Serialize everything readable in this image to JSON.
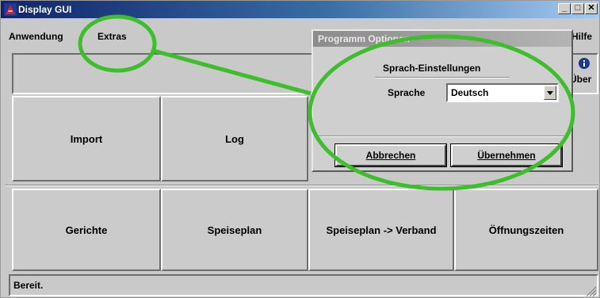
{
  "window": {
    "title": "Display GUI",
    "controls": {
      "minimize": "_",
      "maximize": "□",
      "close": "✕"
    }
  },
  "menubar": {
    "items": [
      {
        "label": "Anwendung"
      },
      {
        "label": "Extras"
      }
    ],
    "help": "Hilfe"
  },
  "about": {
    "label": "Über",
    "icon": "info-icon"
  },
  "buttons": {
    "row1": [
      "Import",
      "Log"
    ],
    "row2": [
      "Gerichte",
      "Speiseplan",
      "Speiseplan -> Verband",
      "Öffnungszeiten"
    ]
  },
  "statusbar": {
    "text": "Bereit."
  },
  "dialog": {
    "title": "Programm Optionen",
    "section_heading": "Sprach-Einstellungen",
    "language_label": "Sprache",
    "language_value": "Deutsch",
    "cancel_label": "Abbrechen",
    "apply_label": "Übernehmen"
  },
  "annotation": {
    "color": "#3dbe2b"
  },
  "colors": {
    "title_start": "#10246a",
    "title_end": "#a6caf0",
    "window_bg": "#c9c9c9"
  }
}
